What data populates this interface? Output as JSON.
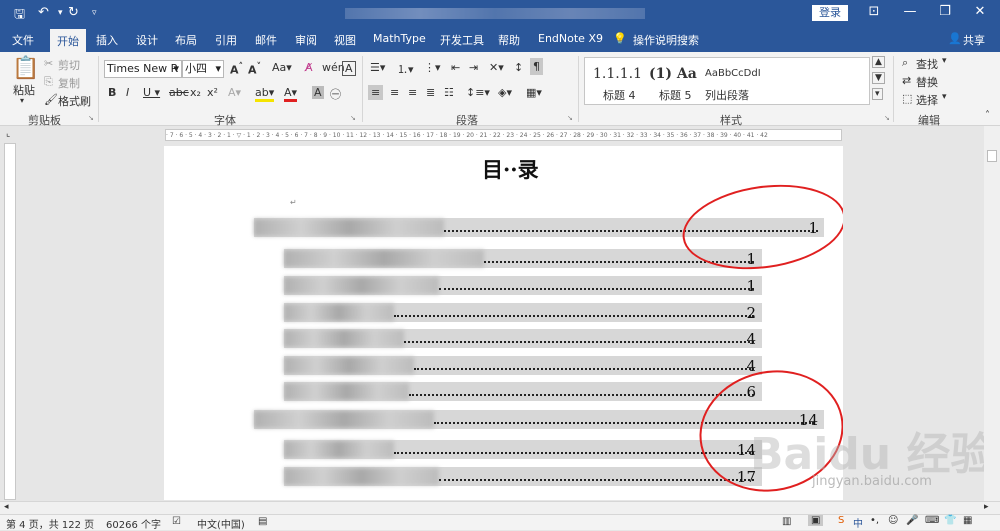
{
  "titlebar": {
    "login": "登录"
  },
  "tabs": [
    "文件",
    "开始",
    "插入",
    "设计",
    "布局",
    "引用",
    "邮件",
    "审阅",
    "视图",
    "MathType",
    "开发工具",
    "帮助",
    "EndNote X9",
    "操作说明搜索"
  ],
  "share": "共享",
  "clipboard": {
    "paste": "粘贴",
    "cut": "剪切",
    "copy": "复制",
    "format_painter": "格式刷",
    "label": "剪贴板"
  },
  "font": {
    "name": "Times New R",
    "size": "小四",
    "label": "字体"
  },
  "paragraph": {
    "label": "段落"
  },
  "styles": {
    "label": "样式",
    "items": [
      {
        "preview": "1.1.1.1",
        "name": "标题 4"
      },
      {
        "preview": "(1) AaI",
        "name": "标题 5"
      },
      {
        "preview": "AaBbCcDdI",
        "name": "列出段落"
      }
    ]
  },
  "editing": {
    "find": "查找",
    "replace": "替换",
    "select": "选择",
    "label": "编辑"
  },
  "document": {
    "title": "目··录",
    "toc": [
      {
        "page": "1"
      },
      {
        "page": "1"
      },
      {
        "page": "1"
      },
      {
        "page": "2"
      },
      {
        "page": "4"
      },
      {
        "page": "4"
      },
      {
        "page": "6"
      },
      {
        "page": "14"
      },
      {
        "page": "14"
      },
      {
        "page": "17"
      }
    ]
  },
  "status": {
    "page": "第 4 页，共 122 页",
    "words": "60266 个字",
    "lang": "中文(中国)"
  },
  "watermark": {
    "main": "Baidu 经验",
    "sub": "jingyan.baidu.com"
  },
  "colors": {
    "accent": "#2b579a",
    "annotation": "#e02020"
  }
}
